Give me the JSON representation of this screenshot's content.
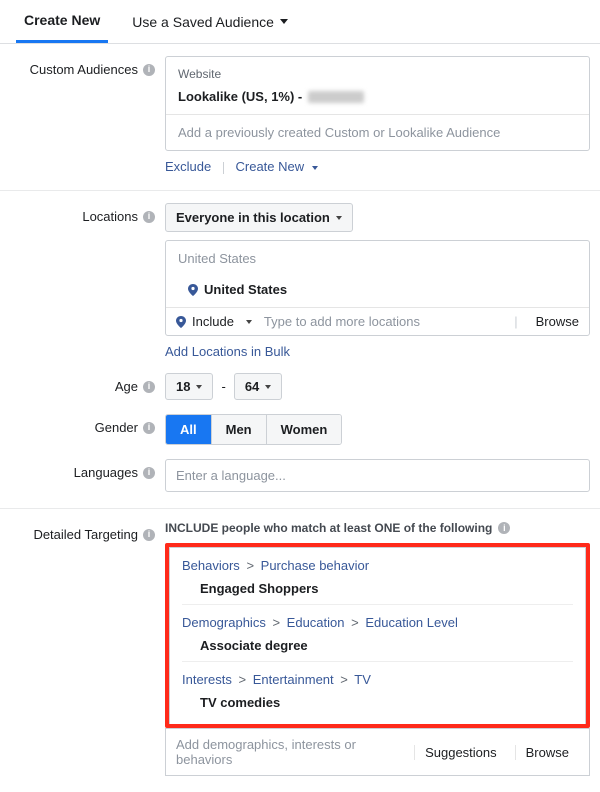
{
  "tabs": {
    "create_new": "Create New",
    "use_saved": "Use a Saved Audience"
  },
  "custom_audiences": {
    "label": "Custom Audiences",
    "source": "Website",
    "item_prefix": "Lookalike (US, 1%) -",
    "placeholder": "Add a previously created Custom or Lookalike Audience",
    "exclude": "Exclude",
    "create_new": "Create New"
  },
  "locations": {
    "label": "Locations",
    "scope": "Everyone in this location",
    "country_heading": "United States",
    "selected": "United States",
    "include": "Include",
    "add_placeholder": "Type to add more locations",
    "browse": "Browse",
    "bulk": "Add Locations in Bulk"
  },
  "age": {
    "label": "Age",
    "min": "18",
    "max": "64"
  },
  "gender": {
    "label": "Gender",
    "all": "All",
    "men": "Men",
    "women": "Women"
  },
  "languages": {
    "label": "Languages",
    "placeholder": "Enter a language..."
  },
  "targeting": {
    "label": "Detailed Targeting",
    "header": "INCLUDE people who match at least ONE of the following",
    "breadcrumbs": {
      "b1a": "Behaviors",
      "b1b": "Purchase behavior",
      "d1a": "Demographics",
      "d1b": "Education",
      "d1c": "Education Level",
      "i1a": "Interests",
      "i1b": "Entertainment",
      "i1c": "TV"
    },
    "values": {
      "v1": "Engaged Shoppers",
      "v2": "Associate degree",
      "v3": "TV comedies"
    },
    "add_placeholder": "Add demographics, interests or behaviors",
    "suggestions": "Suggestions",
    "browse": "Browse"
  },
  "sep": ">"
}
